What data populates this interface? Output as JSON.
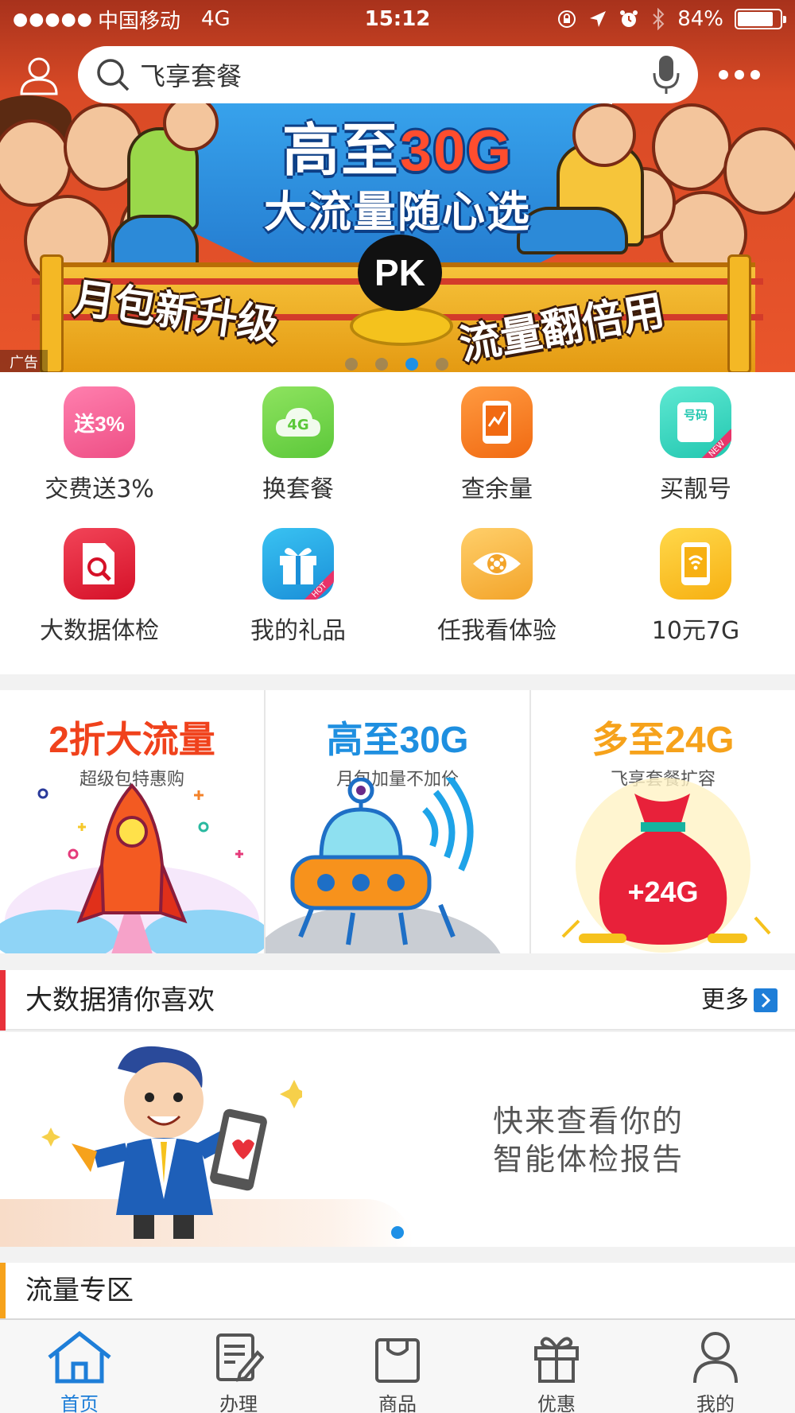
{
  "status_bar": {
    "signal": "●●●●●",
    "carrier": "中国移动",
    "network": "4G",
    "time": "15:12",
    "battery": "84%",
    "battery_level": 0.84
  },
  "search": {
    "placeholder": "飞享套餐"
  },
  "banner": {
    "headline_prefix": "高至",
    "headline_highlight": "30G",
    "subheadline": "大流量随心选",
    "badge": "PK",
    "slogan_left": "月包新升级",
    "slogan_right": "流量翻倍用",
    "ad_tag": "广告",
    "slide_count": 4,
    "active_slide": 3
  },
  "services": [
    {
      "label": "交费送3%",
      "icon": "pay-bonus-icon",
      "icon_text": "送3%",
      "color": "#f0568f"
    },
    {
      "label": "换套餐",
      "icon": "cloud-4g-icon",
      "icon_text": "4G",
      "color": "#6dd34c"
    },
    {
      "label": "查余量",
      "icon": "phone-chart-icon",
      "icon_text": "",
      "color": "#f77a1e"
    },
    {
      "label": "买靓号",
      "icon": "number-card-icon",
      "icon_text": "号码",
      "color": "#3dd6c3",
      "corner": "NEW"
    },
    {
      "label": "大数据体检",
      "icon": "report-search-icon",
      "icon_text": "",
      "color": "#e8213a"
    },
    {
      "label": "我的礼品",
      "icon": "gift-icon",
      "icon_text": "",
      "color": "#22a9e8",
      "corner": "HOT"
    },
    {
      "label": "任我看体验",
      "icon": "film-eye-icon",
      "icon_text": "",
      "color": "#f6b43a"
    },
    {
      "label": "10元7G",
      "icon": "phone-wifi-icon",
      "icon_text": "",
      "color": "#f7b81a"
    }
  ],
  "promos": [
    {
      "title": "2折大流量",
      "subtitle": "超级包特惠购",
      "color": "#f0421c"
    },
    {
      "title": "高至30G",
      "subtitle": "月包加量不加价",
      "color": "#1e8fe0"
    },
    {
      "title": "多至24G",
      "subtitle": "飞享套餐扩容",
      "color": "#f6a21b",
      "bag_text": "+24G"
    }
  ],
  "bigdata_section": {
    "title": "大数据猜你喜欢",
    "more": "更多",
    "accent": "#e8313a",
    "line1": "快来查看你的",
    "line2": "智能体检报告"
  },
  "traffic_section": {
    "title": "流量专区",
    "accent": "#f6a21b"
  },
  "tabs": [
    {
      "label": "首页",
      "icon": "home-icon",
      "active": true
    },
    {
      "label": "办理",
      "icon": "edit-form-icon",
      "active": false
    },
    {
      "label": "商品",
      "icon": "shopping-bag-icon",
      "active": false
    },
    {
      "label": "优惠",
      "icon": "gift-box-icon",
      "active": false
    },
    {
      "label": "我的",
      "icon": "person-icon",
      "active": false
    }
  ]
}
